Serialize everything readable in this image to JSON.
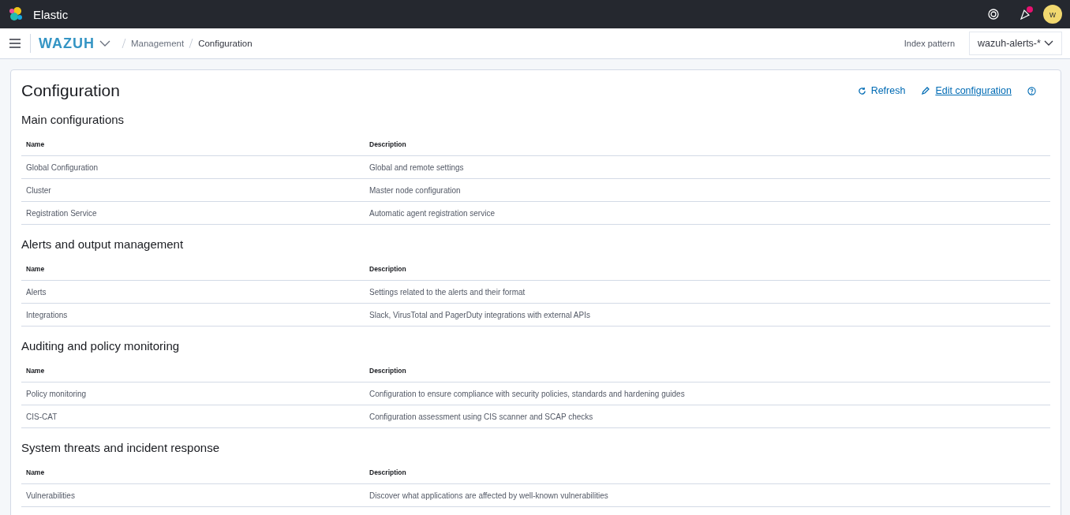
{
  "header": {
    "brand": "Elastic",
    "avatar": "w",
    "notification_badge": true
  },
  "breadcrumb": {
    "app": "WAZUH",
    "items": [
      "Management",
      "Configuration"
    ]
  },
  "index_pattern": {
    "label": "Index pattern",
    "value": "wazuh-alerts-*"
  },
  "page": {
    "title": "Configuration",
    "actions": [
      {
        "kind": "refresh",
        "label": "Refresh"
      },
      {
        "kind": "edit",
        "label": "Edit configuration"
      },
      {
        "kind": "help"
      }
    ]
  },
  "sections": [
    {
      "title": "Main configurations",
      "columns": [
        "Name",
        "Description"
      ],
      "rows": [
        {
          "name": "Global Configuration",
          "description": "Global and remote settings"
        },
        {
          "name": "Cluster",
          "description": "Master node configuration"
        },
        {
          "name": "Registration Service",
          "description": "Automatic agent registration service"
        }
      ]
    },
    {
      "title": "Alerts and output management",
      "columns": [
        "Name",
        "Description"
      ],
      "rows": [
        {
          "name": "Alerts",
          "description": "Settings related to the alerts and their format"
        },
        {
          "name": "Integrations",
          "description": "Slack, VirusTotal and PagerDuty integrations with external APIs"
        }
      ]
    },
    {
      "title": "Auditing and policy monitoring",
      "columns": [
        "Name",
        "Description"
      ],
      "rows": [
        {
          "name": "Policy monitoring",
          "description": "Configuration to ensure compliance with security policies, standards and hardening guides"
        },
        {
          "name": "CIS-CAT",
          "description": "Configuration assessment using CIS scanner and SCAP checks"
        }
      ]
    },
    {
      "title": "System threats and incident response",
      "columns": [
        "Name",
        "Description"
      ],
      "rows": [
        {
          "name": "Vulnerabilities",
          "description": "Discover what applications are affected by well-known vulnerabilities"
        }
      ]
    }
  ]
}
